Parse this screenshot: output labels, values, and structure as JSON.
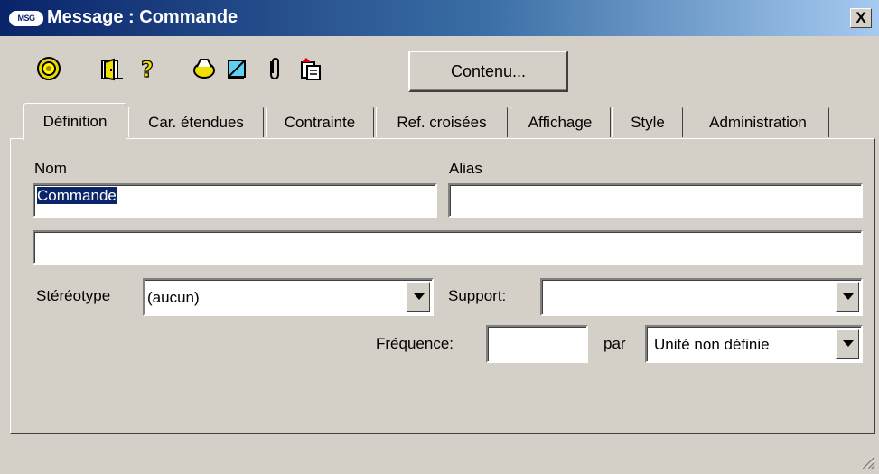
{
  "window": {
    "title": "Message : Commande",
    "app_icon_text": "MSG",
    "close_label": "X"
  },
  "toolbar": {
    "icons": [
      "properties-icon",
      "door-icon",
      "help-icon",
      "dependencies-icon",
      "notes-icon",
      "attachment-icon",
      "copy-icon"
    ],
    "contenu_label": "Contenu..."
  },
  "tabs": [
    {
      "label": "Définition",
      "active": true
    },
    {
      "label": "Car. étendues",
      "active": false
    },
    {
      "label": "Contrainte",
      "active": false
    },
    {
      "label": "Ref. croisées",
      "active": false
    },
    {
      "label": "Affichage",
      "active": false
    },
    {
      "label": "Style",
      "active": false
    },
    {
      "label": "Administration",
      "active": false
    }
  ],
  "form": {
    "nom_label": "Nom",
    "nom_value": "Commande",
    "alias_label": "Alias",
    "alias_value": "",
    "description_value": "",
    "stereotype_label": "Stéréotype",
    "stereotype_value": "(aucun)",
    "support_label": "Support:",
    "support_value": "",
    "frequence_label": "Fréquence:",
    "frequence_value": "",
    "par_label": "par",
    "unite_value": "Unité non définie"
  }
}
